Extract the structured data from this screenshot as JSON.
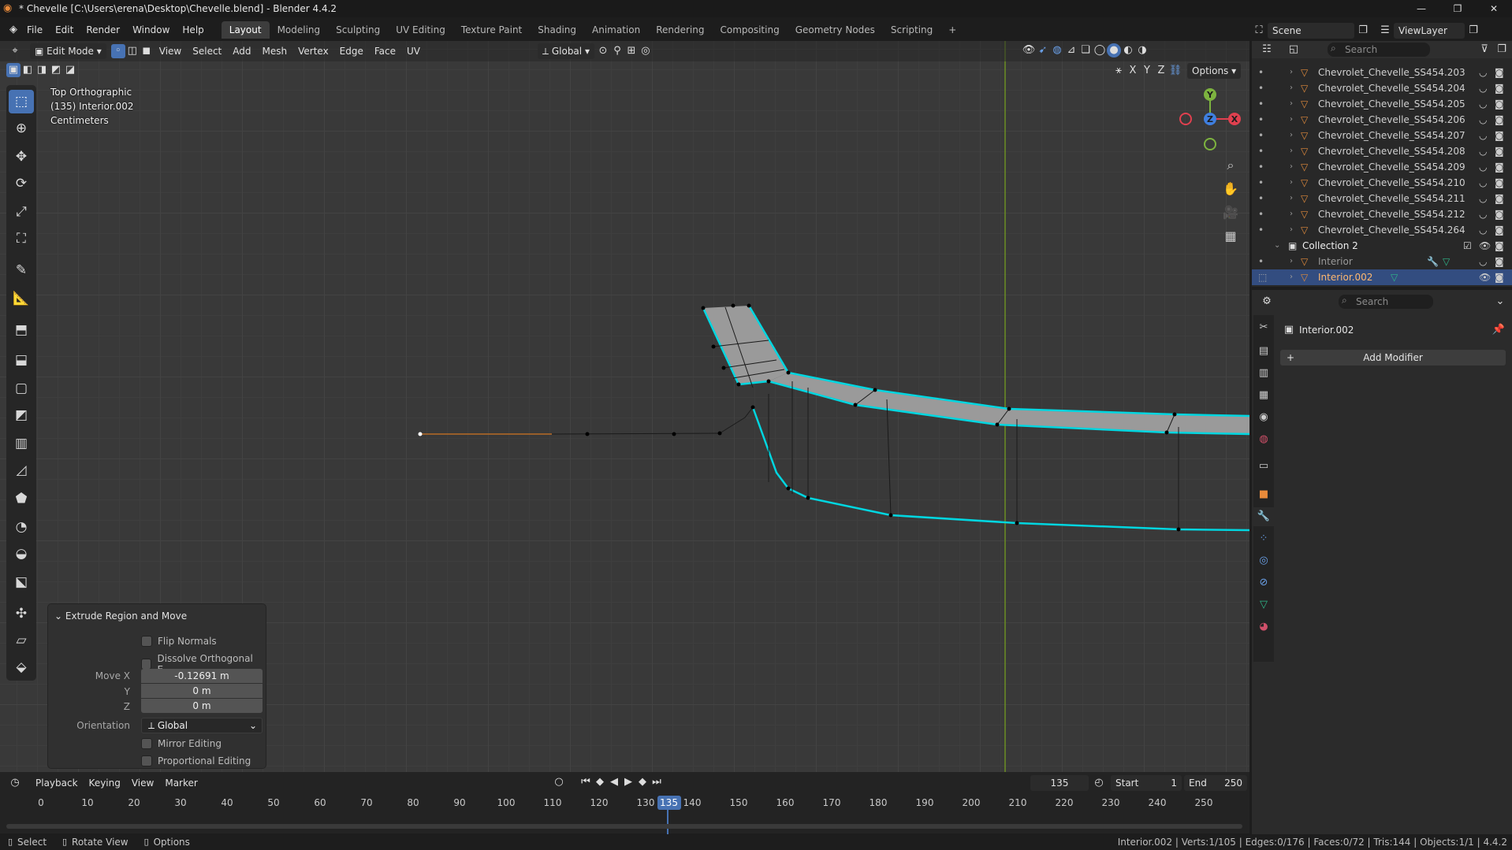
{
  "window": {
    "title": "* Chevelle [C:\\Users\\erena\\Desktop\\Chevelle.blend] - Blender 4.4.2"
  },
  "menu": [
    "File",
    "Edit",
    "Render",
    "Window",
    "Help"
  ],
  "workspaces": [
    "Layout",
    "Modeling",
    "Sculpting",
    "UV Editing",
    "Texture Paint",
    "Shading",
    "Animation",
    "Rendering",
    "Compositing",
    "Geometry Nodes",
    "Scripting"
  ],
  "active_workspace": "Layout",
  "scene": {
    "label": "Scene",
    "view_layer": "ViewLayer"
  },
  "viewport_header": {
    "mode": "Edit Mode",
    "menus": [
      "View",
      "Select",
      "Add",
      "Mesh",
      "Vertex",
      "Edge",
      "Face",
      "UV"
    ],
    "orientation": "Global",
    "options_label": "Options",
    "axes": [
      "X",
      "Y",
      "Z"
    ]
  },
  "viewport_info": {
    "view": "Top Orthographic",
    "object": "(135) Interior.002",
    "units": "Centimeters"
  },
  "gizmo_axes": {
    "y": "Y",
    "z": "Z",
    "x": "X"
  },
  "redo_panel": {
    "title": "Extrude Region and Move",
    "flip_normals": "Flip Normals",
    "dissolve": "Dissolve Orthogonal E...",
    "move_x_label": "Move X",
    "move_x": "-0.12691 m",
    "y_label": "Y",
    "y": "0 m",
    "z_label": "Z",
    "z": "0 m",
    "orientation_label": "Orientation",
    "orientation": "Global",
    "mirror": "Mirror Editing",
    "proportional": "Proportional Editing"
  },
  "timeline": {
    "menus": [
      "Playback",
      "Keying",
      "View",
      "Marker"
    ],
    "current_frame": "135",
    "start_label": "Start",
    "start": "1",
    "end_label": "End",
    "end": "250",
    "ticks": [
      "0",
      "10",
      "20",
      "30",
      "40",
      "50",
      "60",
      "70",
      "80",
      "90",
      "100",
      "110",
      "120",
      "130",
      "140",
      "150",
      "160",
      "170",
      "180",
      "190",
      "200",
      "210",
      "220",
      "230",
      "240",
      "250"
    ]
  },
  "outliner": {
    "search_placeholder": "Search",
    "items": [
      {
        "label": "Chevrolet_Chevelle_SS454.203"
      },
      {
        "label": "Chevrolet_Chevelle_SS454.204"
      },
      {
        "label": "Chevrolet_Chevelle_SS454.205"
      },
      {
        "label": "Chevrolet_Chevelle_SS454.206"
      },
      {
        "label": "Chevrolet_Chevelle_SS454.207"
      },
      {
        "label": "Chevrolet_Chevelle_SS454.208"
      },
      {
        "label": "Chevrolet_Chevelle_SS454.209"
      },
      {
        "label": "Chevrolet_Chevelle_SS454.210"
      },
      {
        "label": "Chevrolet_Chevelle_SS454.211"
      },
      {
        "label": "Chevrolet_Chevelle_SS454.212"
      },
      {
        "label": "Chevrolet_Chevelle_SS454.264"
      }
    ],
    "collection": "Collection 2",
    "collection_items": [
      {
        "label": "Interior"
      },
      {
        "label": "Interior.002"
      }
    ]
  },
  "properties": {
    "search_placeholder": "Search",
    "object_name": "Interior.002",
    "add_modifier": "Add Modifier"
  },
  "statusbar": {
    "select": "Select",
    "rotate": "Rotate View",
    "options": "Options",
    "stats": "Interior.002 | Verts:1/105 | Edges:0/176 | Faces:0/72 | Tris:144 | Objects:1/1 | 4.4.2"
  },
  "colors": {
    "accent": "#4772b3",
    "selection_edge": "#00d6e0",
    "y_axis_line": "#6b8e23",
    "x_axis": "#e0404f",
    "y_axis": "#7db33f",
    "z_axis": "#3f7fe0"
  }
}
